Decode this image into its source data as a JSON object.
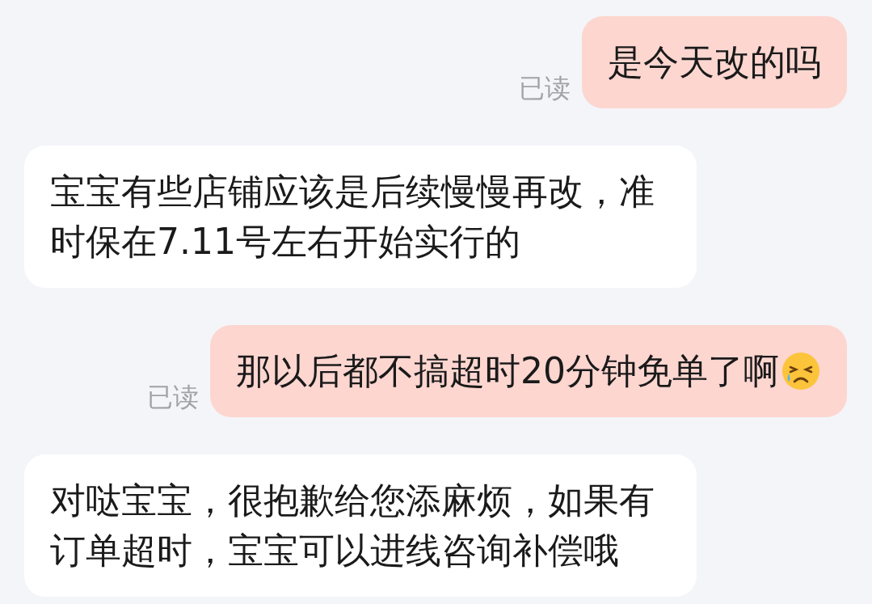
{
  "messages": [
    {
      "kind": "sent",
      "text": "是今天改的吗",
      "read_status": "已读",
      "trailing_emoji": false
    },
    {
      "kind": "received",
      "text": "宝宝有些店铺应该是后续慢慢再改，准时保在7.11号左右开始实行的"
    },
    {
      "kind": "sent",
      "text": "那以后都不搞超时20分钟免单了啊",
      "read_status": "已读",
      "trailing_emoji": true
    },
    {
      "kind": "received",
      "text": "对哒宝宝，很抱歉给您添麻烦，如果有订单超时，宝宝可以进线咨询补偿哦"
    }
  ]
}
